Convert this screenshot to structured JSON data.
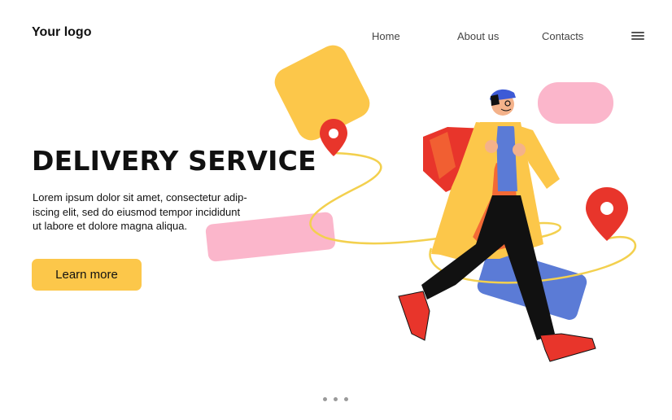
{
  "header": {
    "logo": "Your logo",
    "nav": [
      {
        "label": "Home"
      },
      {
        "label": "About us"
      },
      {
        "label": "Contacts"
      }
    ],
    "menu_icon": "hamburger-menu-icon"
  },
  "hero": {
    "title": "DELIVERY SERVICE",
    "description_lines": [
      "Lorem ipsum dolor sit amet, consectetur adip-",
      "iscing elit, sed do eiusmod tempor incididunt",
      "ut labore et dolore magna aliqua."
    ],
    "button_label": "Learn more"
  },
  "carousel": {
    "dot_count": 3
  },
  "colors": {
    "accent_yellow": "#fcc74a",
    "pink": "#fbb6cb",
    "blue": "#5b7bd6",
    "red": "#e8352b",
    "orange": "#f36a35"
  },
  "illustration": {
    "subject": "courier-walking-with-backpack",
    "icons": [
      "location-pin-icon",
      "location-pin-icon"
    ]
  }
}
